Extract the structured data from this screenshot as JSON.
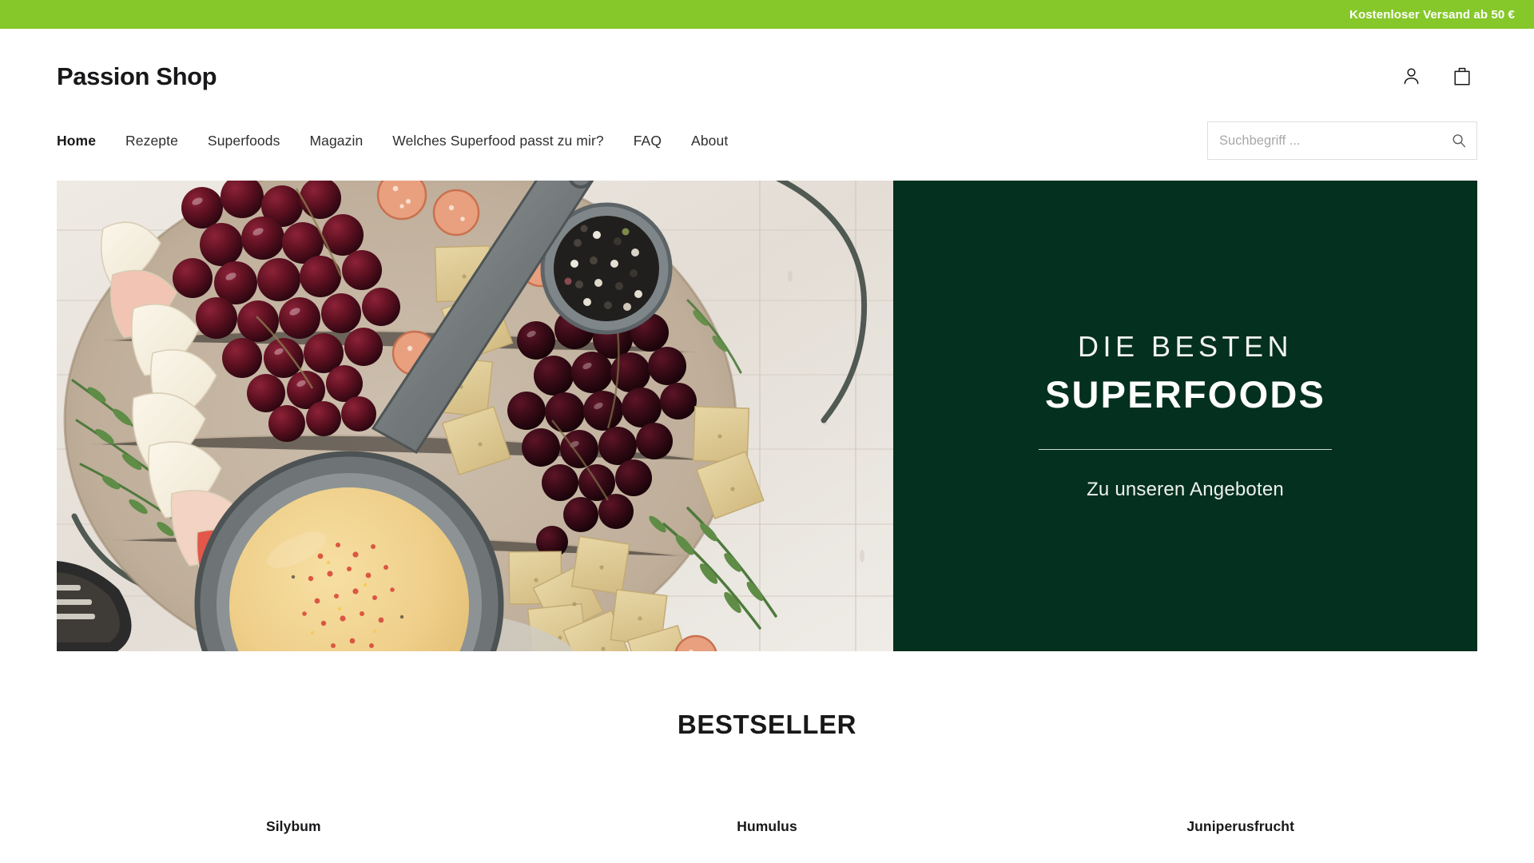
{
  "promo": {
    "text": "Kostenloser Versand ab 50 €",
    "background": "#86c82a",
    "text_color": "#ffffff"
  },
  "header": {
    "logo": "Passion Shop",
    "icons": [
      {
        "name": "account-icon",
        "label": "Konto"
      },
      {
        "name": "cart-icon",
        "label": "Warenkorb"
      }
    ],
    "nav": [
      {
        "label": "Home",
        "active": true
      },
      {
        "label": "Rezepte",
        "active": false
      },
      {
        "label": "Superfoods",
        "active": false
      },
      {
        "label": "Magazin",
        "active": false
      },
      {
        "label": "Welches Superfood passt zu mir?",
        "active": false
      },
      {
        "label": "FAQ",
        "active": false
      },
      {
        "label": "About",
        "active": false
      }
    ],
    "search": {
      "placeholder": "Suchbegriff ...",
      "value": ""
    }
  },
  "hero": {
    "kicker": "DIE BESTEN",
    "title": "SUPERFOODS",
    "cta": "Zu unseren Angeboten",
    "panel_color": "#04301f",
    "image_alt": "Charcuterie-Brett mit Trauben, Apfelscheiben, Crackern, Rosmarin und Käsedip"
  },
  "bestseller": {
    "title": "BESTSELLER",
    "products": [
      {
        "name": "Silybum"
      },
      {
        "name": "Humulus"
      },
      {
        "name": "Juniperusfrucht"
      }
    ]
  }
}
